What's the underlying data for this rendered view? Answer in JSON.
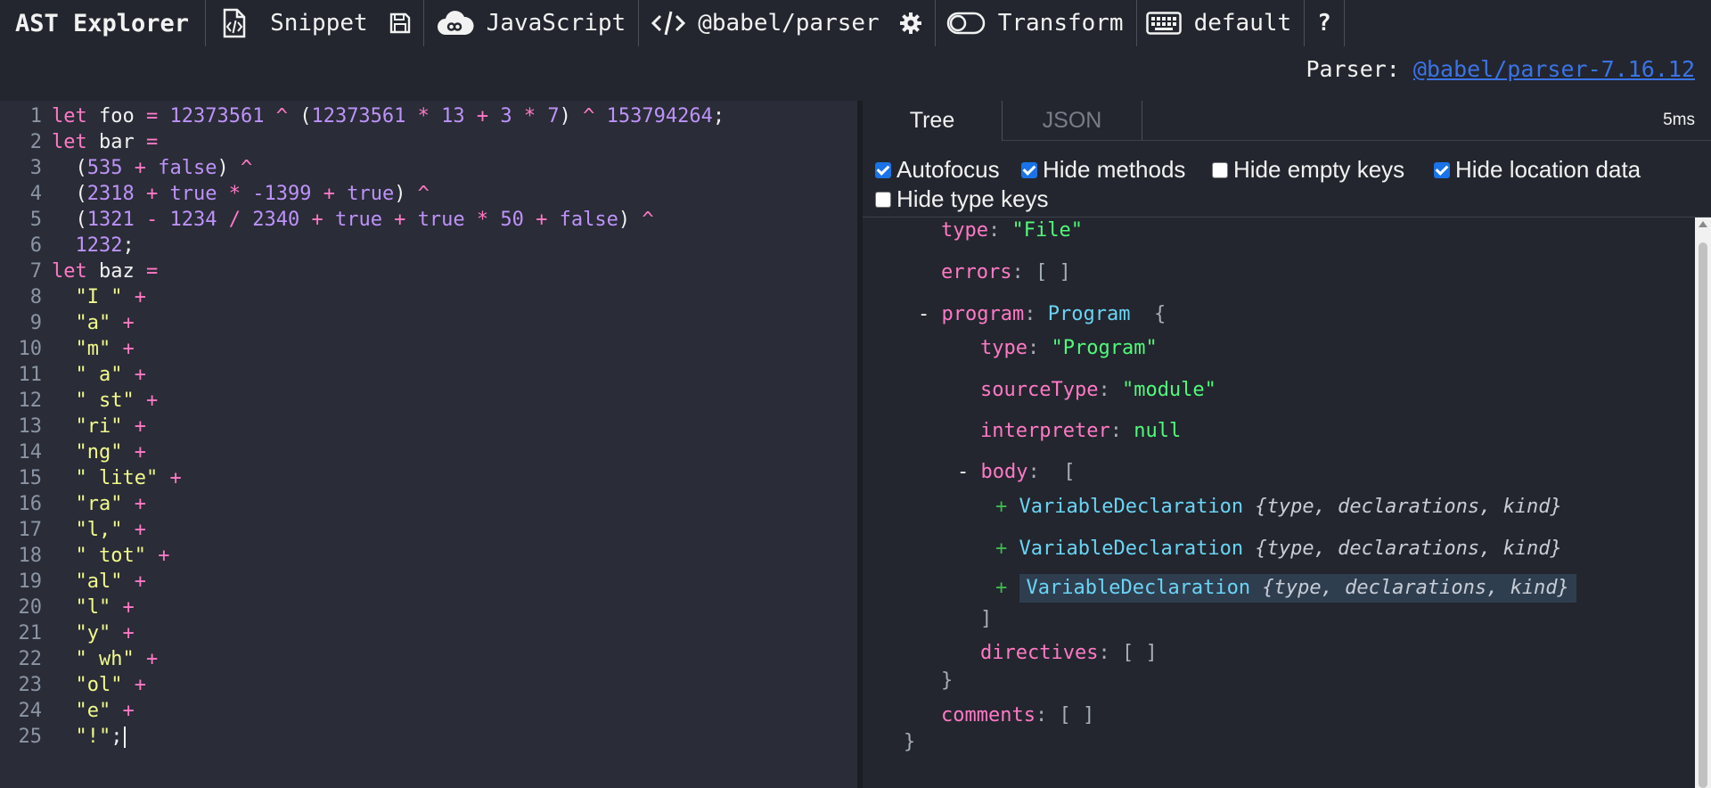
{
  "toolbar": {
    "title": "AST Explorer",
    "snippet_label": "Snippet",
    "language_label": "JavaScript",
    "parser_label": "@babel/parser",
    "transform_label": "Transform",
    "keymap_label": "default",
    "help_label": "?"
  },
  "parser_info": {
    "label": "Parser: ",
    "link": "@babel/parser-7.16.12"
  },
  "editor": {
    "lines": [
      {
        "n": "1",
        "t": [
          [
            "kw",
            "let "
          ],
          [
            "var",
            "foo"
          ],
          [
            "op",
            " = "
          ],
          [
            "num",
            "12373561"
          ],
          [
            "op",
            " ^ "
          ],
          [
            "code",
            "("
          ],
          [
            "num",
            "12373561"
          ],
          [
            "op",
            " * "
          ],
          [
            "num",
            "13"
          ],
          [
            "op",
            " + "
          ],
          [
            "num",
            "3"
          ],
          [
            "op",
            " * "
          ],
          [
            "num",
            "7"
          ],
          [
            "code",
            ")"
          ],
          [
            "op",
            " ^ "
          ],
          [
            "num",
            "153794264"
          ],
          [
            "code",
            ";"
          ]
        ]
      },
      {
        "n": "2",
        "t": [
          [
            "kw",
            "let "
          ],
          [
            "var",
            "bar"
          ],
          [
            "op",
            " ="
          ]
        ]
      },
      {
        "n": "3",
        "t": [
          [
            "code",
            "  ("
          ],
          [
            "num",
            "535"
          ],
          [
            "op",
            " + "
          ],
          [
            "num",
            "false"
          ],
          [
            "code",
            ")"
          ],
          [
            "op",
            " ^"
          ]
        ]
      },
      {
        "n": "4",
        "t": [
          [
            "code",
            "  ("
          ],
          [
            "num",
            "2318"
          ],
          [
            "op",
            " + "
          ],
          [
            "num",
            "true"
          ],
          [
            "op",
            " * "
          ],
          [
            "num",
            "-1399"
          ],
          [
            "op",
            " + "
          ],
          [
            "num",
            "true"
          ],
          [
            "code",
            ")"
          ],
          [
            "op",
            " ^"
          ]
        ]
      },
      {
        "n": "5",
        "t": [
          [
            "code",
            "  ("
          ],
          [
            "num",
            "1321"
          ],
          [
            "op",
            " - "
          ],
          [
            "num",
            "1234"
          ],
          [
            "op",
            " / "
          ],
          [
            "num",
            "2340"
          ],
          [
            "op",
            " + "
          ],
          [
            "num",
            "true"
          ],
          [
            "op",
            " + "
          ],
          [
            "num",
            "true"
          ],
          [
            "op",
            " * "
          ],
          [
            "num",
            "50"
          ],
          [
            "op",
            " + "
          ],
          [
            "num",
            "false"
          ],
          [
            "code",
            ")"
          ],
          [
            "op",
            " ^"
          ]
        ]
      },
      {
        "n": "6",
        "t": [
          [
            "code",
            "  "
          ],
          [
            "num",
            "1232"
          ],
          [
            "code",
            ";"
          ]
        ]
      },
      {
        "n": "7",
        "t": [
          [
            "kw",
            "let "
          ],
          [
            "var",
            "baz"
          ],
          [
            "op",
            " ="
          ]
        ]
      },
      {
        "n": "8",
        "t": [
          [
            "code",
            "  "
          ],
          [
            "str",
            "\"I \""
          ],
          [
            "op",
            " +"
          ]
        ]
      },
      {
        "n": "9",
        "t": [
          [
            "code",
            "  "
          ],
          [
            "str",
            "\"a\""
          ],
          [
            "op",
            " +"
          ]
        ]
      },
      {
        "n": "10",
        "t": [
          [
            "code",
            "  "
          ],
          [
            "str",
            "\"m\""
          ],
          [
            "op",
            " +"
          ]
        ]
      },
      {
        "n": "11",
        "t": [
          [
            "code",
            "  "
          ],
          [
            "str",
            "\" a\""
          ],
          [
            "op",
            " +"
          ]
        ]
      },
      {
        "n": "12",
        "t": [
          [
            "code",
            "  "
          ],
          [
            "str",
            "\" st\""
          ],
          [
            "op",
            " +"
          ]
        ]
      },
      {
        "n": "13",
        "t": [
          [
            "code",
            "  "
          ],
          [
            "str",
            "\"ri\""
          ],
          [
            "op",
            " +"
          ]
        ]
      },
      {
        "n": "14",
        "t": [
          [
            "code",
            "  "
          ],
          [
            "str",
            "\"ng\""
          ],
          [
            "op",
            " +"
          ]
        ]
      },
      {
        "n": "15",
        "t": [
          [
            "code",
            "  "
          ],
          [
            "str",
            "\" lite\""
          ],
          [
            "op",
            " +"
          ]
        ]
      },
      {
        "n": "16",
        "t": [
          [
            "code",
            "  "
          ],
          [
            "str",
            "\"ra\""
          ],
          [
            "op",
            " +"
          ]
        ]
      },
      {
        "n": "17",
        "t": [
          [
            "code",
            "  "
          ],
          [
            "str",
            "\"l,\""
          ],
          [
            "op",
            " +"
          ]
        ]
      },
      {
        "n": "18",
        "t": [
          [
            "code",
            "  "
          ],
          [
            "str",
            "\" tot\""
          ],
          [
            "op",
            " +"
          ]
        ]
      },
      {
        "n": "19",
        "t": [
          [
            "code",
            "  "
          ],
          [
            "str",
            "\"al\""
          ],
          [
            "op",
            " +"
          ]
        ]
      },
      {
        "n": "20",
        "t": [
          [
            "code",
            "  "
          ],
          [
            "str",
            "\"l\""
          ],
          [
            "op",
            " +"
          ]
        ]
      },
      {
        "n": "21",
        "t": [
          [
            "code",
            "  "
          ],
          [
            "str",
            "\"y\""
          ],
          [
            "op",
            " +"
          ]
        ]
      },
      {
        "n": "22",
        "t": [
          [
            "code",
            "  "
          ],
          [
            "str",
            "\" wh\""
          ],
          [
            "op",
            " +"
          ]
        ]
      },
      {
        "n": "23",
        "t": [
          [
            "code",
            "  "
          ],
          [
            "str",
            "\"ol\""
          ],
          [
            "op",
            " +"
          ]
        ]
      },
      {
        "n": "24",
        "t": [
          [
            "code",
            "  "
          ],
          [
            "str",
            "\"e\""
          ],
          [
            "op",
            " +"
          ]
        ]
      },
      {
        "n": "25",
        "t": [
          [
            "code",
            "  "
          ],
          [
            "str",
            "\"!\""
          ],
          [
            "code",
            ";"
          ]
        ]
      }
    ]
  },
  "output": {
    "tabs": [
      "Tree",
      "JSON"
    ],
    "timing": "5ms",
    "options": [
      {
        "label": "Autofocus",
        "checked": true
      },
      {
        "label": "Hide methods",
        "checked": true
      },
      {
        "label": "Hide empty keys",
        "checked": false
      },
      {
        "label": "Hide location data",
        "checked": true
      },
      {
        "label": "Hide type keys",
        "checked": false
      }
    ],
    "tree": {
      "file_type_key": "type",
      "file_type_val": "\"File\"",
      "errors_key": "errors",
      "errors_val": "[ ]",
      "program_toggle": "-",
      "program_key": "program",
      "program_type": "Program",
      "program_brace": "{",
      "prog_type_key": "type",
      "prog_type_val": "\"Program\"",
      "source_key": "sourceType",
      "source_val": "\"module\"",
      "interp_key": "interpreter",
      "interp_val": "null",
      "body_toggle": "-",
      "body_key": "body",
      "body_bracket": "[",
      "decls": [
        {
          "plus": "+",
          "type": "VariableDeclaration",
          "summary": "{type, declarations, kind}"
        },
        {
          "plus": "+",
          "type": "VariableDeclaration",
          "summary": "{type, declarations, kind}"
        },
        {
          "plus": "+",
          "type": "VariableDeclaration",
          "summary": "{type, declarations, kind}"
        }
      ],
      "body_close": "]",
      "directives_key": "directives",
      "directives_val": "[ ]",
      "program_close": "}",
      "comments_key": "comments",
      "comments_val": "[ ]",
      "root_close": "}"
    }
  }
}
